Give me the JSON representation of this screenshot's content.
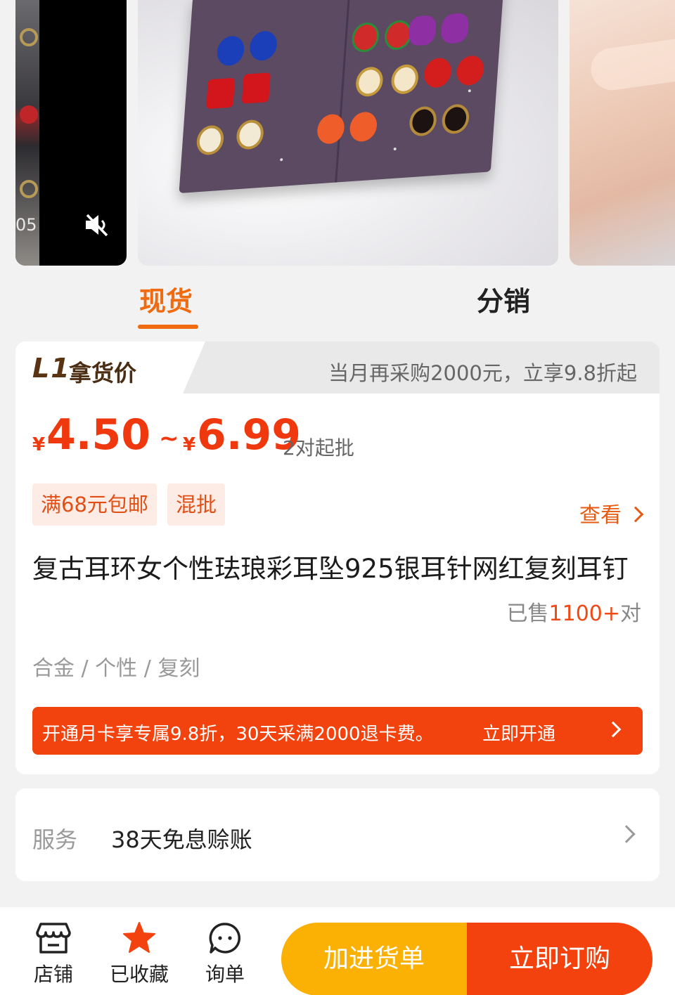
{
  "gallery": {
    "left_counter": "05",
    "mute_icon": "speaker-muted-icon"
  },
  "tabs": [
    {
      "label": "现货",
      "active": true
    },
    {
      "label": "分销",
      "active": false
    }
  ],
  "price_card": {
    "level_badge": "L1",
    "level_title": "拿货价",
    "promo_hint": "当月再采购2000元，立享9.8折起",
    "currency": "¥",
    "price_min": "4.50",
    "price_sep": "~",
    "price_max": "6.99",
    "moq": "2对起批",
    "tags": [
      "满68元包邮",
      "混批"
    ],
    "view_more": "查看",
    "title": "复古耳环女个性珐琅彩耳坠925银耳针网红复刻耳钉",
    "sold_prefix": "已售",
    "sold_count": "1100+",
    "sold_unit": "对",
    "attributes": "合金 / 个性 / 复刻",
    "member_banner_text": "开通月卡享专属9.8折，30天采满2000退卡费。",
    "member_banner_cta": "立即开通"
  },
  "service": {
    "label": "服务",
    "value": "38天免息赊账"
  },
  "bottom_bar": {
    "shop_label": "店铺",
    "favorite_label": "已收藏",
    "inquiry_label": "询单",
    "add_to_cart": "加进货单",
    "buy_now": "立即订购"
  },
  "colors": {
    "accent_orange": "#f06a10",
    "price_red": "#f0380f",
    "cart_yellow": "#fbb103",
    "buy_red": "#f3420d"
  }
}
